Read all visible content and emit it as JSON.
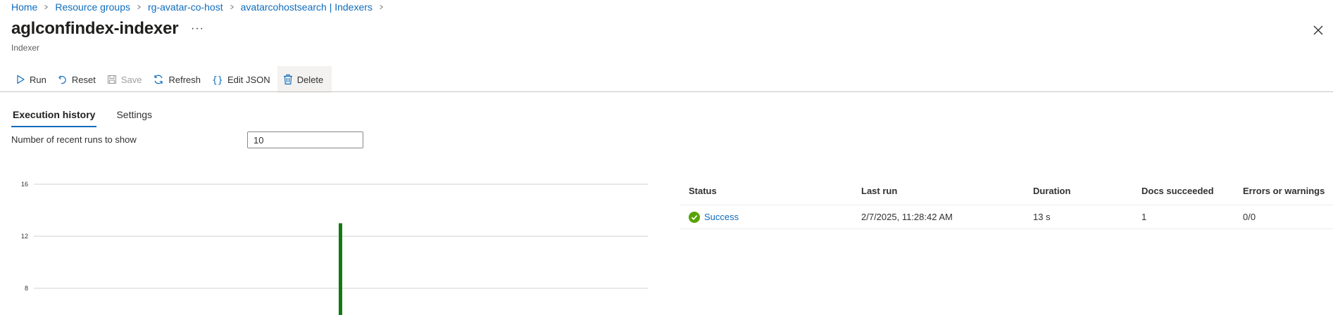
{
  "breadcrumb": [
    "Home",
    "Resource groups",
    "rg-avatar-co-host",
    "avatarcohostsearch | Indexers"
  ],
  "page": {
    "title": "aglconfindex-indexer",
    "subtitle": "Indexer",
    "more": "···"
  },
  "toolbar": {
    "run": "Run",
    "reset": "Reset",
    "save": "Save",
    "refresh": "Refresh",
    "edit_json": "Edit JSON",
    "delete": "Delete"
  },
  "tabs": [
    "Execution history",
    "Settings"
  ],
  "runs": {
    "label": "Number of recent runs to show",
    "value": "10"
  },
  "table": {
    "headers": [
      "Status",
      "Last run",
      "Duration",
      "Docs succeeded",
      "Errors or warnings"
    ],
    "rows": [
      {
        "status": "Success",
        "last_run": "2/7/2025, 11:28:42 AM",
        "duration": "13 s",
        "docs": "1",
        "errors": "0/0"
      }
    ]
  },
  "colors": {
    "accent": "#0f6cbd",
    "success": "#57a300",
    "bar": "#107c10"
  },
  "chart_data": {
    "type": "bar",
    "y_ticks": [
      "16",
      "12",
      "8"
    ],
    "ylim": [
      4,
      16
    ],
    "x_position": 0.5,
    "values": [
      13
    ]
  }
}
